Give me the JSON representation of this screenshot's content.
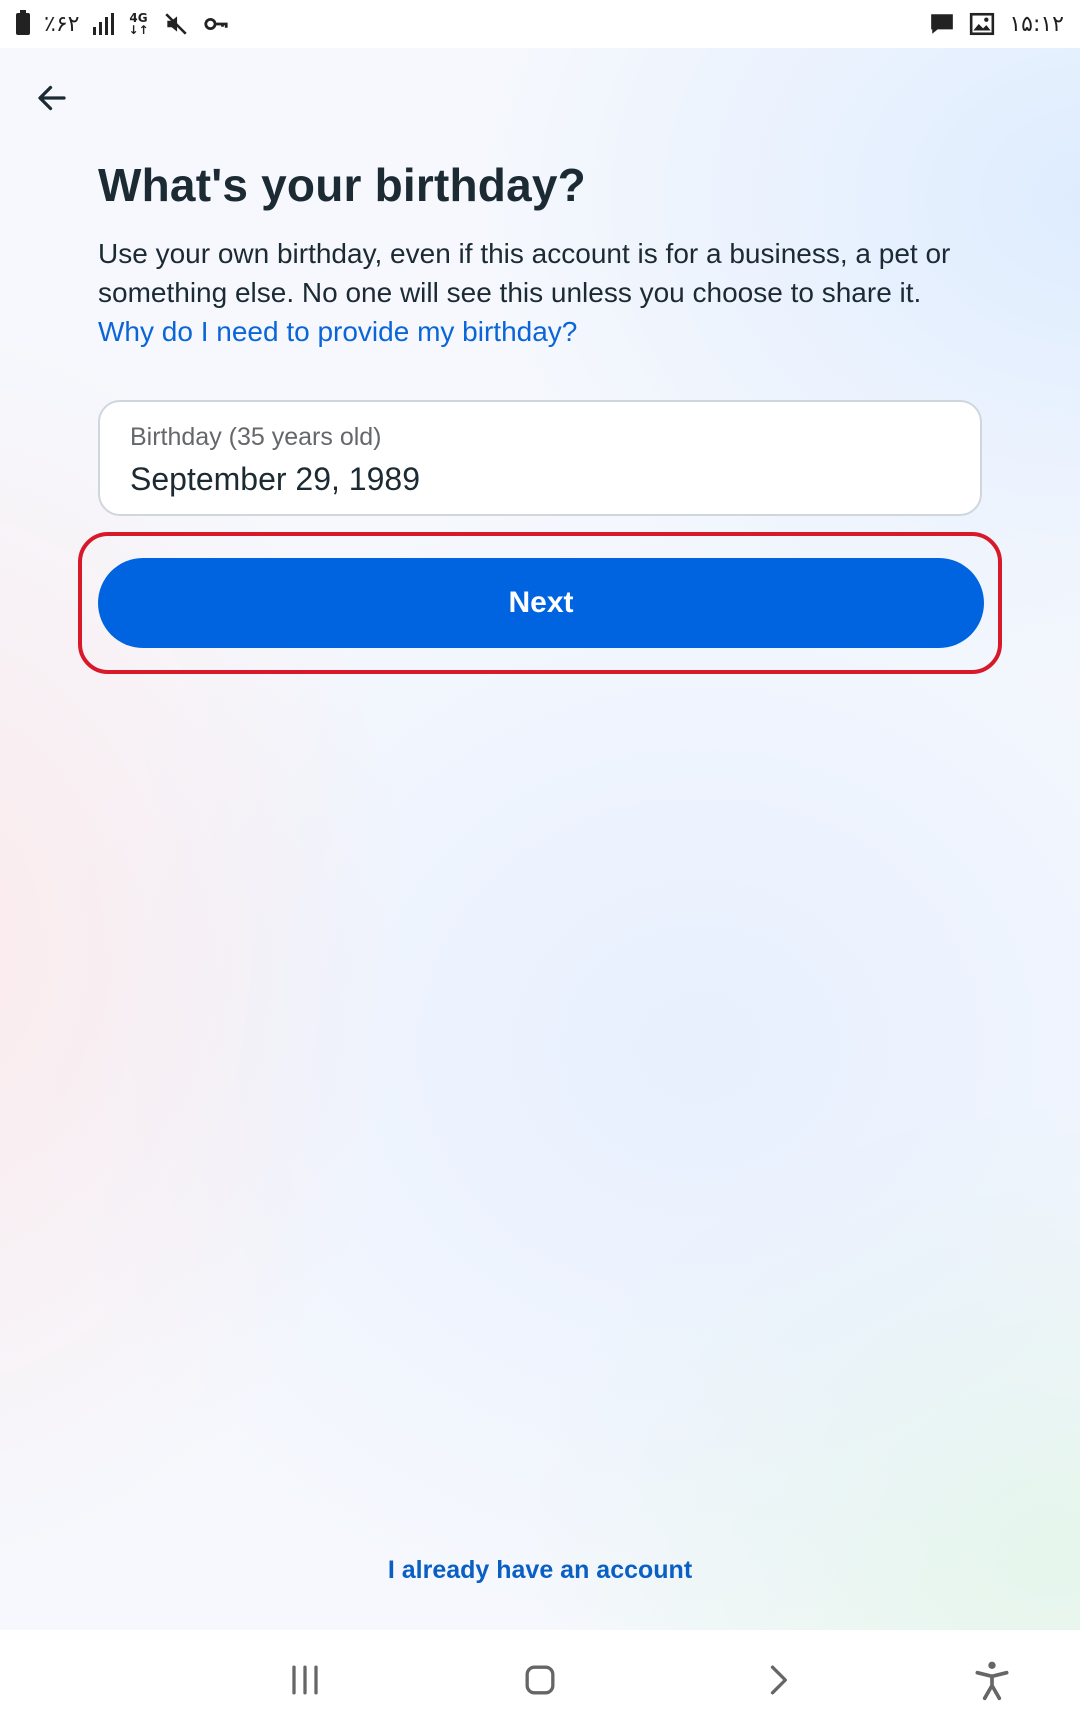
{
  "status_bar": {
    "battery_text": "٪۶۲",
    "network_label": "4G",
    "time": "۱۵:۱۲",
    "icons": [
      "battery-icon",
      "signal-icon",
      "network-4g-icon",
      "mute-icon",
      "key-icon",
      "message-icon",
      "image-icon"
    ]
  },
  "header": {
    "back_icon": "arrow-left-icon"
  },
  "content": {
    "title": "What's your birthday?",
    "description": "Use your own birthday, even if this account is for a business, a pet or something else. No one will see this unless you choose to share it.",
    "help_link": "Why do I need to provide my birthday?"
  },
  "birthday_field": {
    "label": "Birthday (35 years old)",
    "value": "September 29, 1989"
  },
  "next_button": {
    "label": "Next"
  },
  "footer": {
    "login_link": "I already have an account"
  },
  "nav_bar": {
    "icons": [
      "recent-apps-icon",
      "home-icon",
      "back-chevron-icon",
      "accessibility-icon"
    ]
  },
  "colors": {
    "primary": "#0064e0",
    "link": "#0a66d8",
    "text": "#1c2b33",
    "highlight": "#d7192a"
  }
}
